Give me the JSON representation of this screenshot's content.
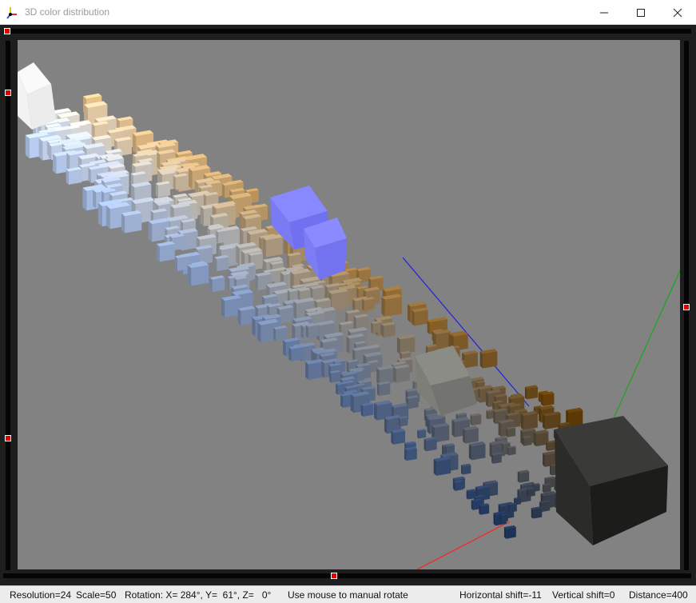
{
  "window": {
    "title": "3D color distribution",
    "icon": "axes-app-icon",
    "controls": [
      "minimize-icon",
      "maximize-icon",
      "close-icon"
    ]
  },
  "scene": {
    "background": "#828282",
    "axis_colors": {
      "x": "#ff2020",
      "y": "#18a818",
      "z": "#2020e0"
    }
  },
  "sliders": {
    "top": {
      "value": 0.0
    },
    "left": {
      "value": 0.09
    },
    "right": {
      "value": 0.5
    },
    "left_lower": {
      "value": 0.75
    },
    "bottom": {
      "value": 0.48
    }
  },
  "status": {
    "resolution": "Resolution=24",
    "scale": "Scale=50",
    "rotation": "Rotation: X= 284°, Y=  61°, Z=   0°",
    "hint": "Use mouse to manual rotate",
    "hshift": "Horizontal shift=-11",
    "vshift": "Vertical shift=0",
    "distance": "Distance=400"
  }
}
